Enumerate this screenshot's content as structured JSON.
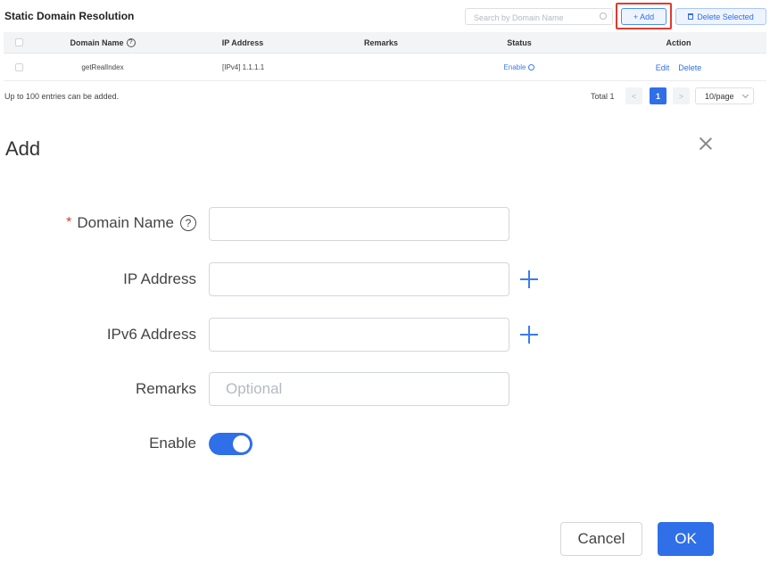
{
  "panel": {
    "title": "Static Domain Resolution",
    "search_placeholder": "Search by Domain Name",
    "add_label": "+ Add",
    "delete_selected_label": "Delete Selected"
  },
  "table": {
    "columns": {
      "domain": "Domain Name",
      "ip": "IP Address",
      "remarks": "Remarks",
      "status": "Status",
      "action": "Action"
    },
    "rows": [
      {
        "domain": "getRealIndex",
        "ip": "[IPv4] 1.1.1.1",
        "remarks": "",
        "status": "Enable",
        "edit": "Edit",
        "delete": "Delete"
      }
    ]
  },
  "footer": {
    "note": "Up to 100 entries can be added.",
    "total": "Total 1",
    "prev": "<",
    "page": "1",
    "next": ">",
    "page_size": "10/page"
  },
  "dialog": {
    "title": "Add",
    "fields": {
      "domain_label": "Domain Name",
      "domain_value": "",
      "ip_label": "IP Address",
      "ip_value": "",
      "ipv6_label": "IPv6 Address",
      "ipv6_value": "",
      "remarks_label": "Remarks",
      "remarks_placeholder": "Optional",
      "enable_label": "Enable"
    },
    "enable_on": true,
    "cancel_label": "Cancel",
    "ok_label": "OK"
  },
  "icons": {
    "help": "question-circle-icon",
    "add_row": "plus-icon",
    "close": "close-icon",
    "search": "search-icon",
    "trash": "trash-icon"
  },
  "colors": {
    "accent": "#2f6fe8",
    "highlight": "#e23a2f"
  }
}
